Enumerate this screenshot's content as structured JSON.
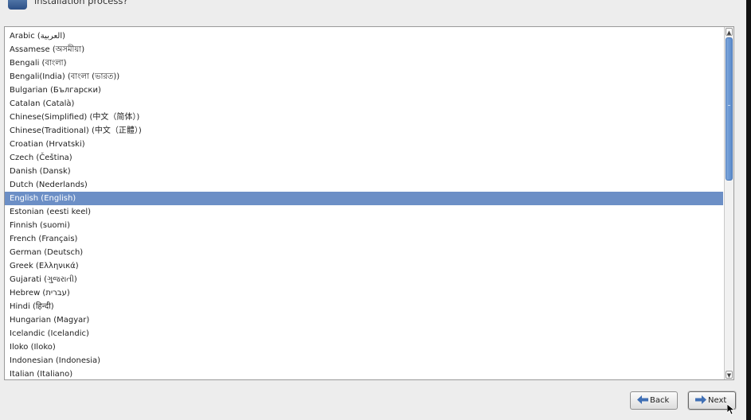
{
  "header": {
    "prompt": "installation process?"
  },
  "languages": [
    "Arabic (العربية)",
    "Assamese (অসমীয়া)",
    "Bengali (বাংলা)",
    "Bengali(India) (বাংলা (ভারত))",
    "Bulgarian (Български)",
    "Catalan (Català)",
    "Chinese(Simplified) (中文（简体）)",
    "Chinese(Traditional) (中文（正體）)",
    "Croatian (Hrvatski)",
    "Czech (Čeština)",
    "Danish (Dansk)",
    "Dutch (Nederlands)",
    "English (English)",
    "Estonian (eesti keel)",
    "Finnish (suomi)",
    "French (Français)",
    "German (Deutsch)",
    "Greek (Ελληνικά)",
    "Gujarati (ગુજરાતી)",
    "Hebrew (עברית)",
    "Hindi (हिन्दी)",
    "Hungarian (Magyar)",
    "Icelandic (Icelandic)",
    "Iloko (Iloko)",
    "Indonesian (Indonesia)",
    "Italian (Italiano)"
  ],
  "selected_language": "English (English)",
  "buttons": {
    "back_label": "Back",
    "next_label": "Next"
  },
  "colors": {
    "selection": "#6c8fc6",
    "scroll_thumb": "#6a97d2",
    "nav_arrow": "#3f6fb5"
  }
}
